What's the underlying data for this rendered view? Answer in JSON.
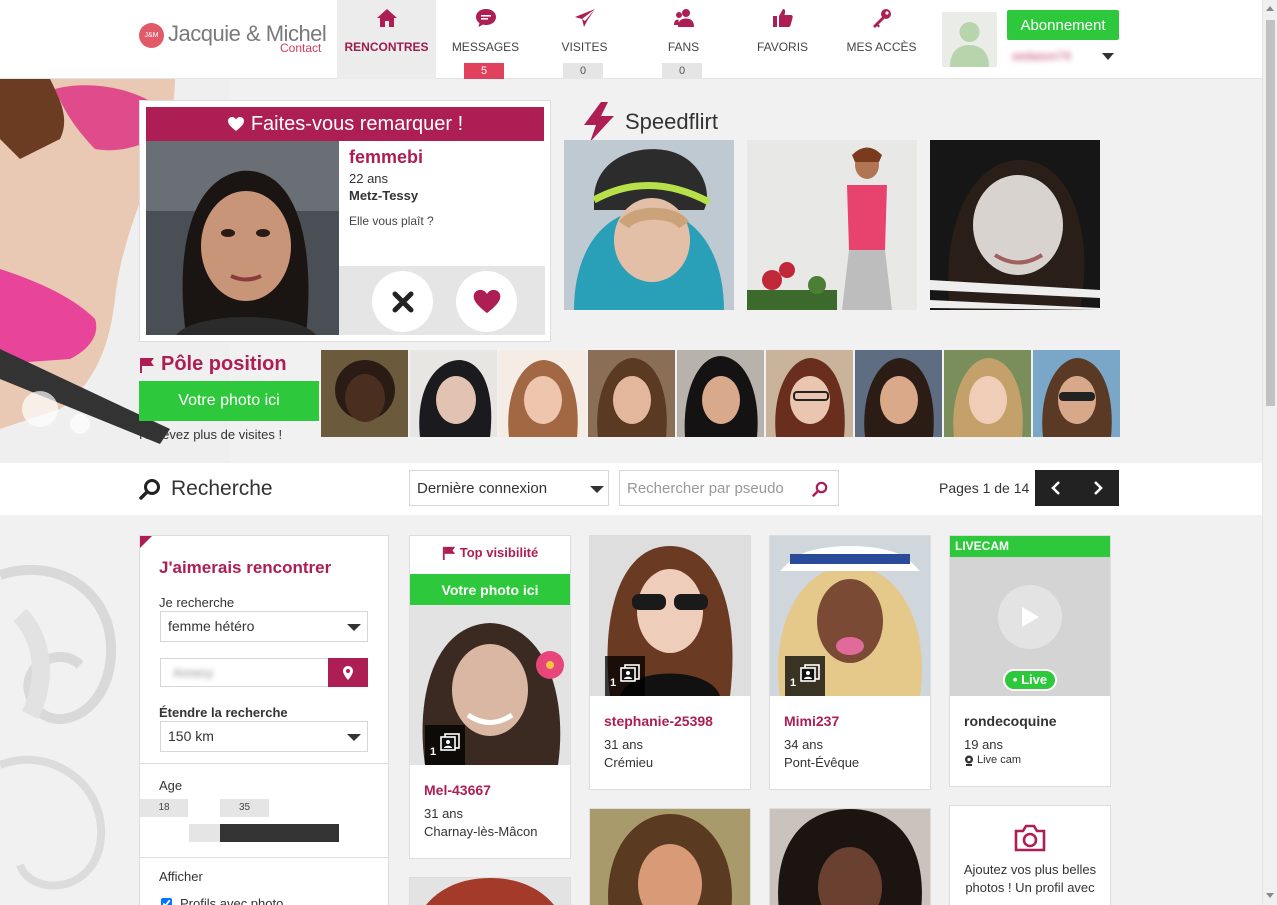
{
  "header": {
    "logo_badge": "J&M",
    "logo_text": "Jacquie & Michel",
    "logo_sub": "Contact",
    "nav": [
      {
        "label": "RENCONTRES",
        "icon": "home-icon",
        "badge": null,
        "active": true
      },
      {
        "label": "MESSAGES",
        "icon": "chat-bubble-icon",
        "badge": "5",
        "active": false
      },
      {
        "label": "VISITES",
        "icon": "paper-plane-icon",
        "badge": "0",
        "active": false
      },
      {
        "label": "FANS",
        "icon": "users-icon",
        "badge": "0",
        "active": false
      },
      {
        "label": "FAVORIS",
        "icon": "thumbs-up-icon",
        "badge": null,
        "active": false
      },
      {
        "label": "MES ACCÈS",
        "icon": "key-icon",
        "badge": null,
        "active": false
      }
    ],
    "subscribe_label": "Abonnement",
    "username": "sedason74"
  },
  "featured": {
    "title": "Faites-vous remarquer !",
    "name": "femmebi",
    "age": "22 ans",
    "city": "Metz-Tessy",
    "question": "Elle vous plaît ?"
  },
  "speedflirt": {
    "title": "Speedflirt"
  },
  "pole": {
    "title": "Pôle position",
    "button": "Votre photo ici",
    "subtitle": "Recevez plus de visites !"
  },
  "search": {
    "title": "Recherche",
    "sort_value": "Dernière connexion",
    "pseudo_placeholder": "Rechercher par pseudo",
    "pages_label": "Pages 1 de 14"
  },
  "filters": {
    "title": "J'aimerais rencontrer",
    "seeking_label": "Je recherche",
    "seeking_value": "femme hétéro",
    "location_value": "Annecy",
    "extend_label": "Étendre la recherche",
    "extend_value": "150 km",
    "age_label": "Age",
    "age_min": "18",
    "age_max": "35",
    "show_label": "Afficher",
    "photo_only_label": "Profils avec photo"
  },
  "cards": {
    "topvis_label": "Top visibilité",
    "topvis_button": "Votre photo ici",
    "topvis_profile": {
      "name": "Mel-43667",
      "age": "31 ans",
      "city": "Charnay-lès-Mâcon",
      "photos": "1"
    },
    "profiles": [
      {
        "name": "stephanie-25398",
        "age": "31 ans",
        "city": "Crémieu",
        "photos": "1"
      },
      {
        "name": "Mimi237",
        "age": "34 ans",
        "city": "Pont-Évêque",
        "photos": "1"
      }
    ],
    "livecam": {
      "head": "LIVECAM",
      "badge": "• Live",
      "name": "rondecoquine",
      "age": "19 ans",
      "sub": "Live cam"
    },
    "add_photo_text": "Ajoutez vos plus belles photos ! Un profil avec"
  },
  "colors": {
    "brand": "#ad1e54",
    "green": "#2ec83c",
    "badge_red": "#e0415d"
  }
}
